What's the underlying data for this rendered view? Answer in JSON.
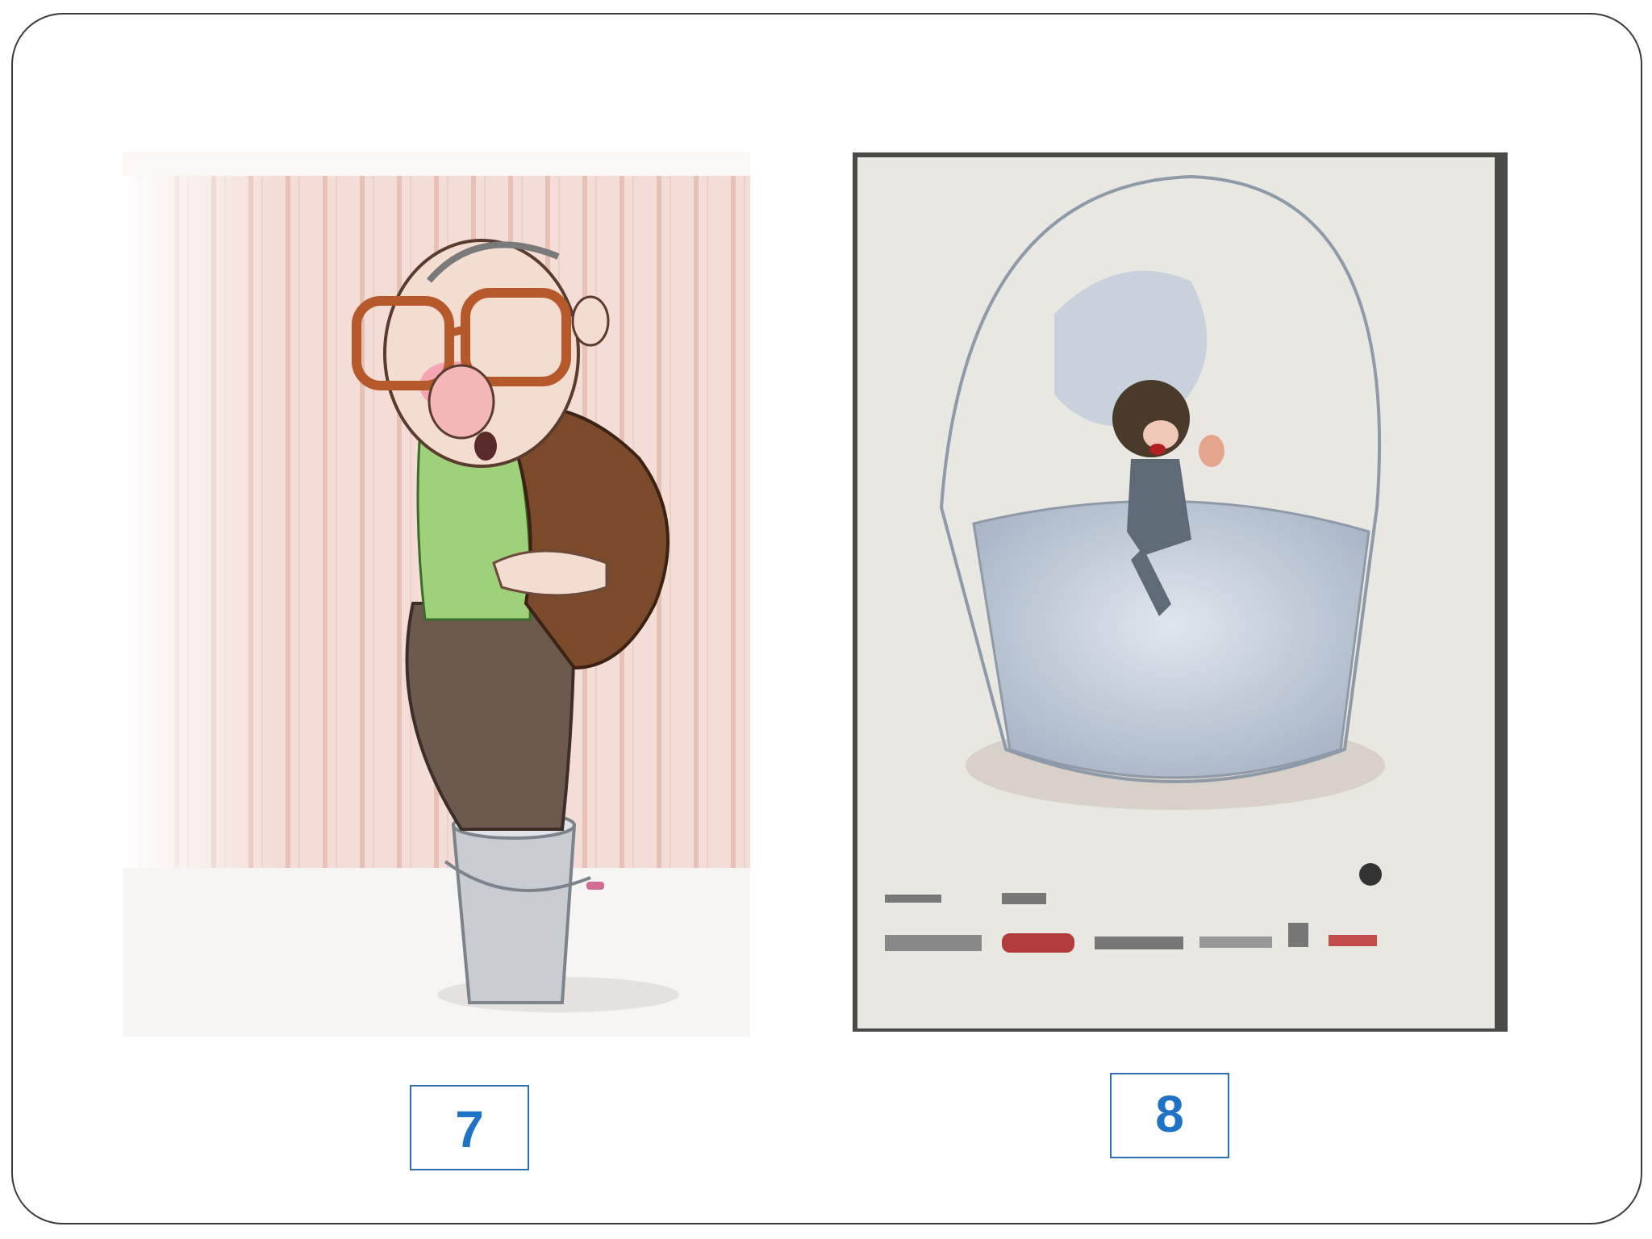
{
  "slide": {
    "items": [
      {
        "number": "7",
        "image": "cartoon-old-man-standing-in-bucket",
        "colors": {
          "wall": "#f2d9d2",
          "stripe": "#e7c2b8",
          "jacket": "#7a4a2b",
          "shirt": "#9fd07a",
          "trousers": "#6b5a4d",
          "bucket": "#c9cdd2"
        }
      },
      {
        "number": "8",
        "image": "poster-person-drowning-in-glass-bucket",
        "colors": {
          "poster": "#e7e6e2",
          "water": "#c9d3df",
          "glass": "#9aa5b3"
        }
      }
    ],
    "label_color": "#1f73c6",
    "label_border": "#2f6fb3"
  }
}
